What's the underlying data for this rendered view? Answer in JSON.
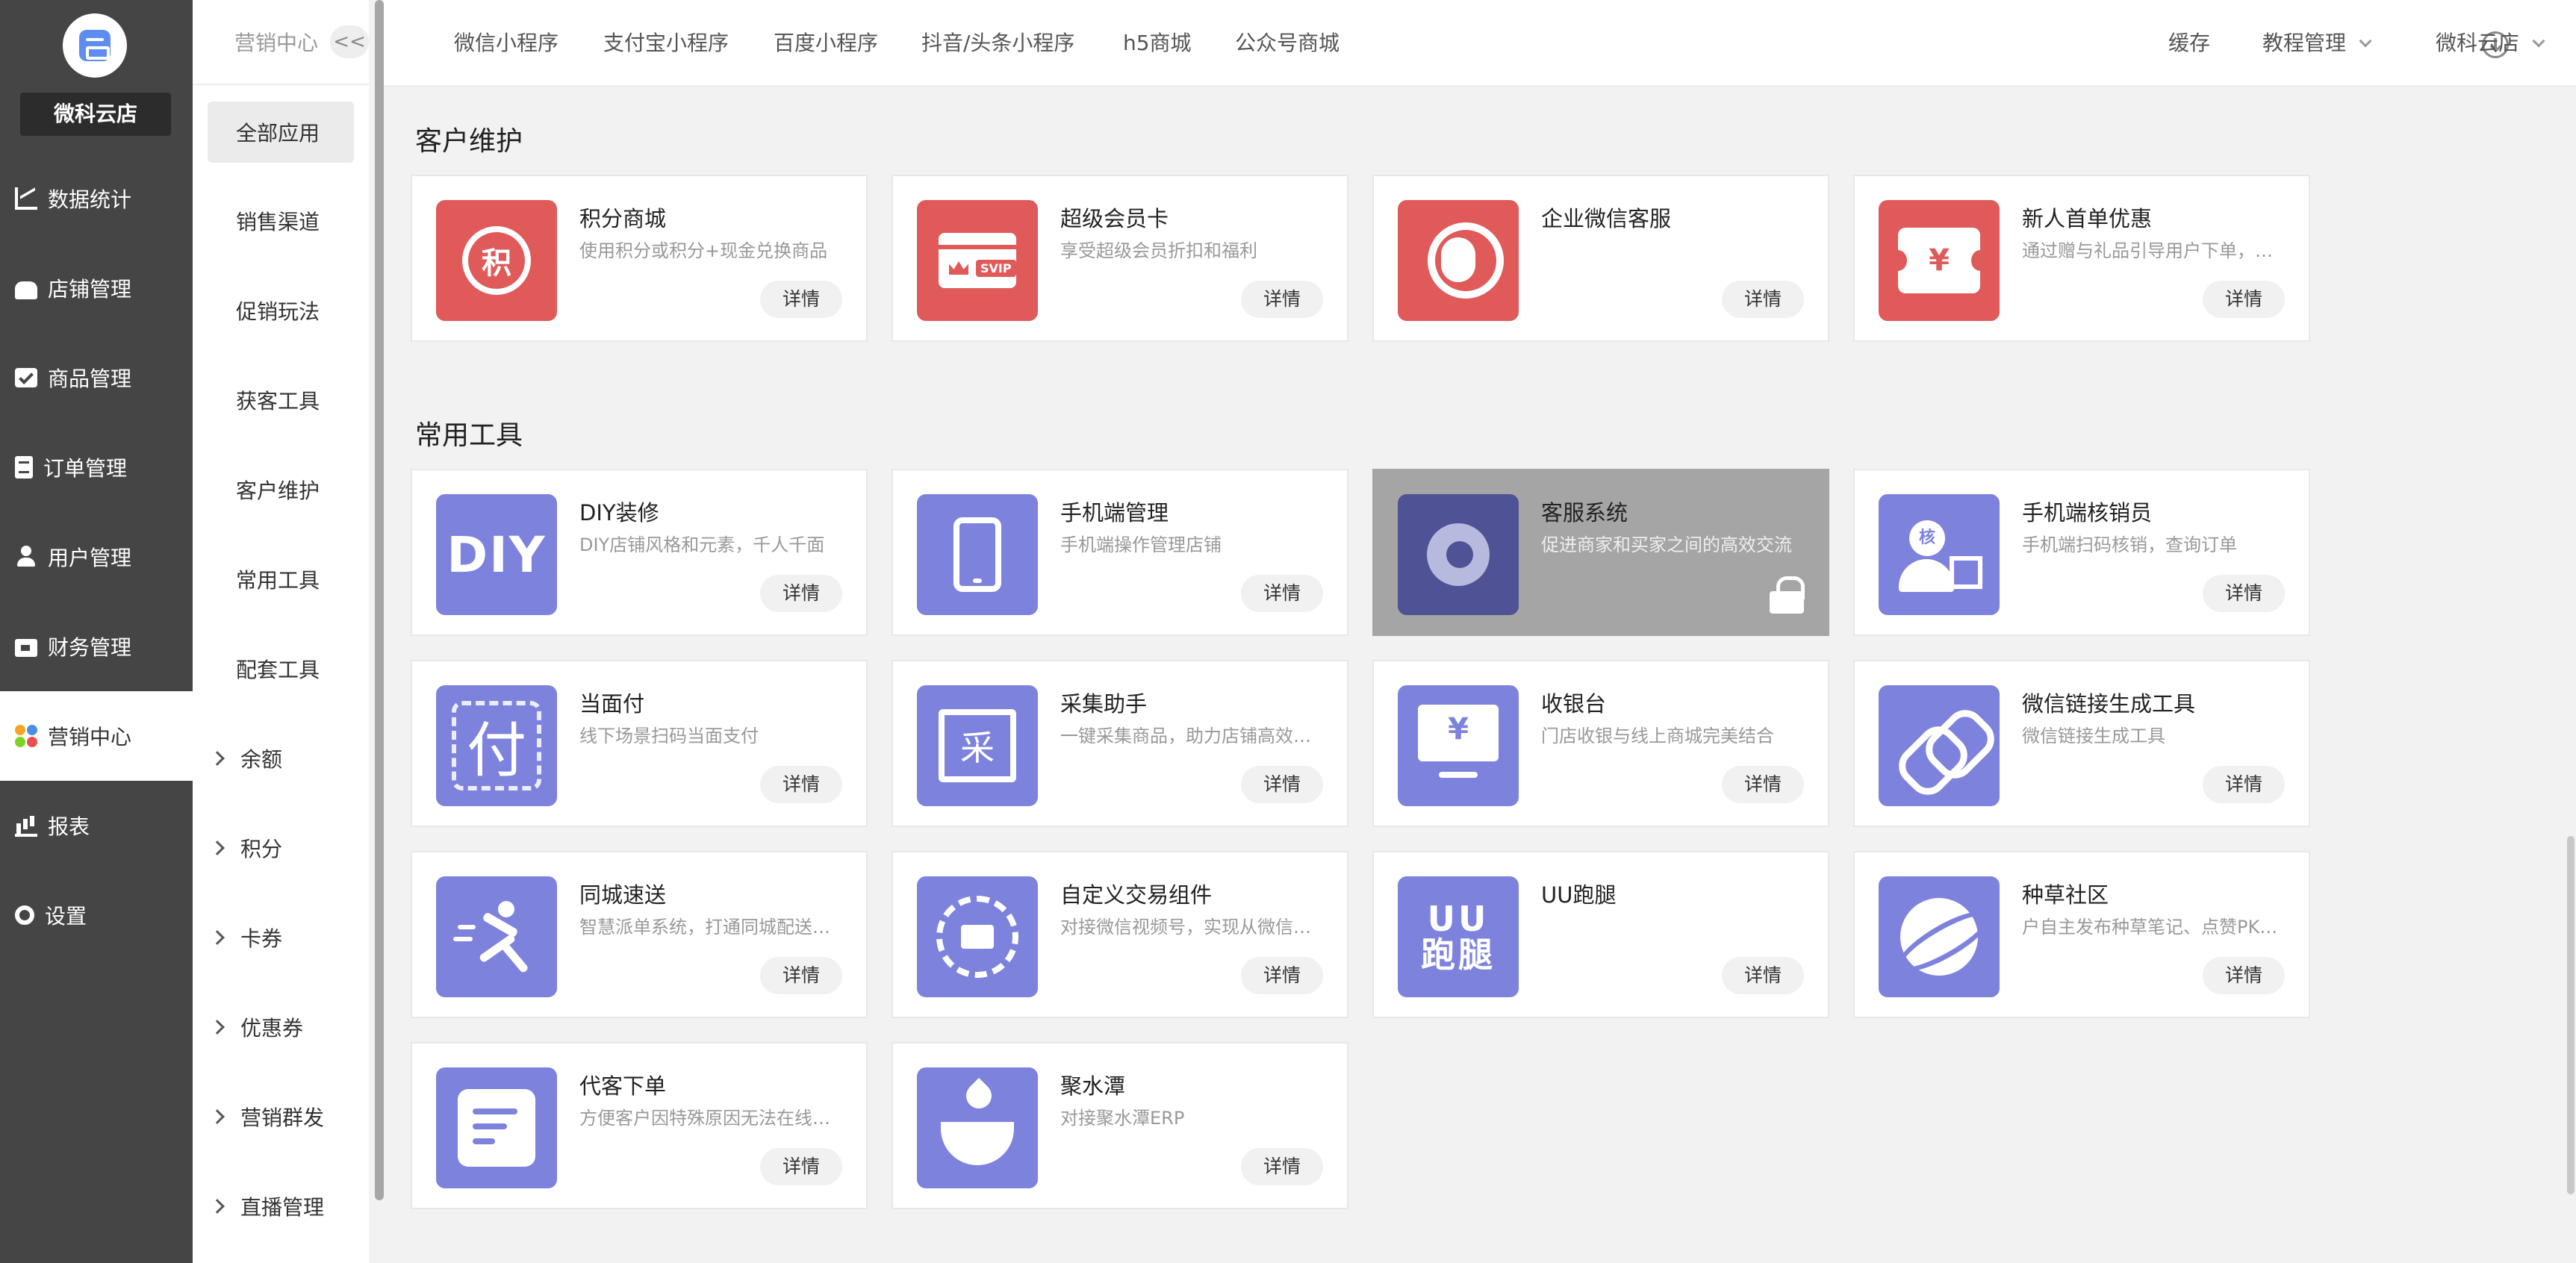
{
  "sidebar": {
    "store_name": "微科云店",
    "items": [
      {
        "label": "数据统计",
        "icon": "chart-icon"
      },
      {
        "label": "店铺管理",
        "icon": "shop-icon"
      },
      {
        "label": "商品管理",
        "icon": "box-icon"
      },
      {
        "label": "订单管理",
        "icon": "order-icon"
      },
      {
        "label": "用户管理",
        "icon": "user-icon"
      },
      {
        "label": "财务管理",
        "icon": "money-icon"
      },
      {
        "label": "营销中心",
        "icon": "marketing-icon",
        "active": true
      },
      {
        "label": "报表",
        "icon": "report-icon"
      },
      {
        "label": "设置",
        "icon": "gear-icon"
      }
    ]
  },
  "submenu": {
    "title": "营销中心",
    "collapse": "<<",
    "items": [
      "全部应用",
      "销售渠道",
      "促销玩法",
      "获客工具",
      "客户维护",
      "常用工具",
      "配套工具"
    ],
    "groups": [
      "余额",
      "积分",
      "卡券",
      "优惠券",
      "营销群发",
      "直播管理"
    ]
  },
  "topbar": {
    "tabs": [
      "微信小程序",
      "支付宝小程序",
      "百度小程序",
      "抖音/头条小程序",
      "h5商城",
      "公众号商城"
    ],
    "cache": "缓存",
    "tutorial": "教程管理",
    "user": "微科云店"
  },
  "detail_label": "详情",
  "sections": [
    {
      "title": "客户维护",
      "cards": [
        {
          "title": "积分商城",
          "desc": "使用积分或积分+现金兑换商品",
          "icon": "points-icon",
          "color": "red"
        },
        {
          "title": "超级会员卡",
          "desc": "享受超级会员折扣和福利",
          "icon": "svip-card-icon",
          "color": "red"
        },
        {
          "title": "企业微信客服",
          "desc": "",
          "icon": "headset-icon",
          "color": "red"
        },
        {
          "title": "新人首单优惠",
          "desc": "通过赠与礼品引导用户下单，…",
          "icon": "coupon-icon",
          "color": "red"
        }
      ]
    },
    {
      "title": "常用工具",
      "cards": [
        {
          "title": "DIY装修",
          "desc": "DIY店铺风格和元素，千人千面",
          "icon": "diy-icon",
          "color": "purple"
        },
        {
          "title": "手机端管理",
          "desc": "手机端操作管理店铺",
          "icon": "phone-icon",
          "color": "purple"
        },
        {
          "title": "客服系统",
          "desc": "促进商家和买家之间的高效交流",
          "icon": "service-icon",
          "color": "purple",
          "locked": true
        },
        {
          "title": "手机端核销员",
          "desc": "手机端扫码核销，查询订单",
          "icon": "verify-icon",
          "color": "purple"
        },
        {
          "title": "当面付",
          "desc": "线下场景扫码当面支付",
          "icon": "pay-icon",
          "color": "purple"
        },
        {
          "title": "采集助手",
          "desc": "一键采集商品，助力店铺高效…",
          "icon": "collect-icon",
          "color": "purple"
        },
        {
          "title": "收银台",
          "desc": "门店收银与线上商城完美结合",
          "icon": "cashier-icon",
          "color": "purple"
        },
        {
          "title": "微信链接生成工具",
          "desc": "微信链接生成工具",
          "icon": "link-icon",
          "color": "purple"
        },
        {
          "title": "同城速送",
          "desc": "智慧派单系统，打通同城配送…",
          "icon": "runner-icon",
          "color": "purple"
        },
        {
          "title": "自定义交易组件",
          "desc": "对接微信视频号，实现从微信…",
          "icon": "trade-component-icon",
          "color": "purple"
        },
        {
          "title": "UU跑腿",
          "desc": "",
          "icon": "uu-icon",
          "color": "purple"
        },
        {
          "title": "种草社区",
          "desc": "户自主发布种草笔记、点赞PK…",
          "icon": "planet-icon",
          "color": "purple"
        },
        {
          "title": "代客下单",
          "desc": "方便客户因特殊原因无法在线…",
          "icon": "note-icon",
          "color": "purple"
        },
        {
          "title": "聚水潭",
          "desc": "对接聚水潭ERP",
          "icon": "water-drop-icon",
          "color": "purple"
        }
      ]
    }
  ],
  "colors": {
    "red": "#e05a5a",
    "purple": "#7d82dd",
    "sidebar": "#454545"
  }
}
